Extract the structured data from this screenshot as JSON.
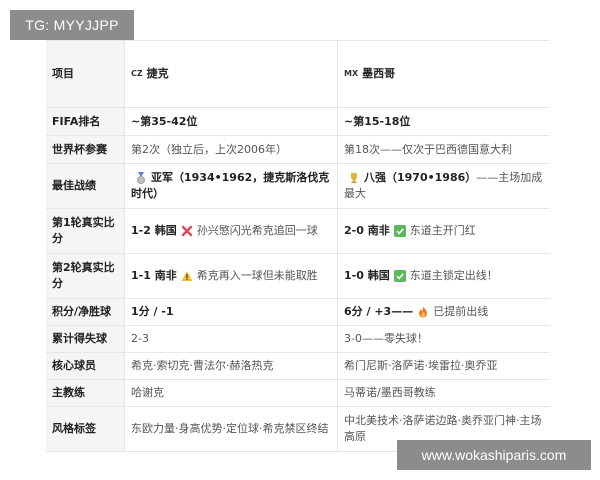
{
  "watermark_top": "TG: MYYJJPP",
  "watermark_bottom": "www.wokashiparis.com",
  "header": {
    "item": "项目",
    "cz_flag": "CZ",
    "cz": "捷克",
    "mx_flag": "MX",
    "mx": "墨西哥"
  },
  "rows": [
    {
      "label": "FIFA排名",
      "cz": "~第35-42位",
      "mx": "~第15-18位"
    },
    {
      "label": "世界杯参赛",
      "cz": "第2次（独立后，上次2006年）",
      "mx": "第18次——仅次于巴西德国意大利"
    },
    {
      "label": "最佳战绩",
      "cz_bold": "亚军（1934•1962，捷克斯洛伐克时代）",
      "mx_bold": "八强（1970•1986）",
      "mx_rest": "——主场加成最大"
    },
    {
      "label": "第1轮真实比分",
      "cz_bold": "1-2 韩国",
      "cz_rest": "孙兴慜闪光希克追回一球",
      "mx_bold": "2-0 南非",
      "mx_rest": "东道主开门红"
    },
    {
      "label": "第2轮真实比分",
      "cz_bold": "1-1 南非",
      "cz_rest": "希克再入一球但未能取胜",
      "mx_bold": "1-0 韩国",
      "mx_rest": "东道主锁定出线！"
    },
    {
      "label": "积分/净胜球",
      "cz": "1分 / -1",
      "mx_bold": "6分 / +3——",
      "mx_rest": "已提前出线"
    },
    {
      "label": "累计得失球",
      "cz": "2-3",
      "mx": "3-0——零失球！"
    },
    {
      "label": "核心球员",
      "cz": "希克·索切克·曹法尔·赫洛热克",
      "mx": "希门尼斯·洛萨诺·埃雷拉·奥乔亚"
    },
    {
      "label": "主教练",
      "cz": "哈谢克",
      "mx": "马蒂诺/墨西哥教练"
    },
    {
      "label": "风格标签",
      "cz": "东欧力量·身高优势·定位球·希克禁区终结",
      "mx": "中北美技术·洛萨诺边路·奥乔亚门神·主场高原"
    }
  ],
  "icons": {
    "medal": "silver-medal-icon",
    "trophy": "trophy-icon",
    "cross": "red-cross-icon",
    "warning": "warning-icon",
    "check": "green-check-icon",
    "fire": "fire-icon"
  }
}
